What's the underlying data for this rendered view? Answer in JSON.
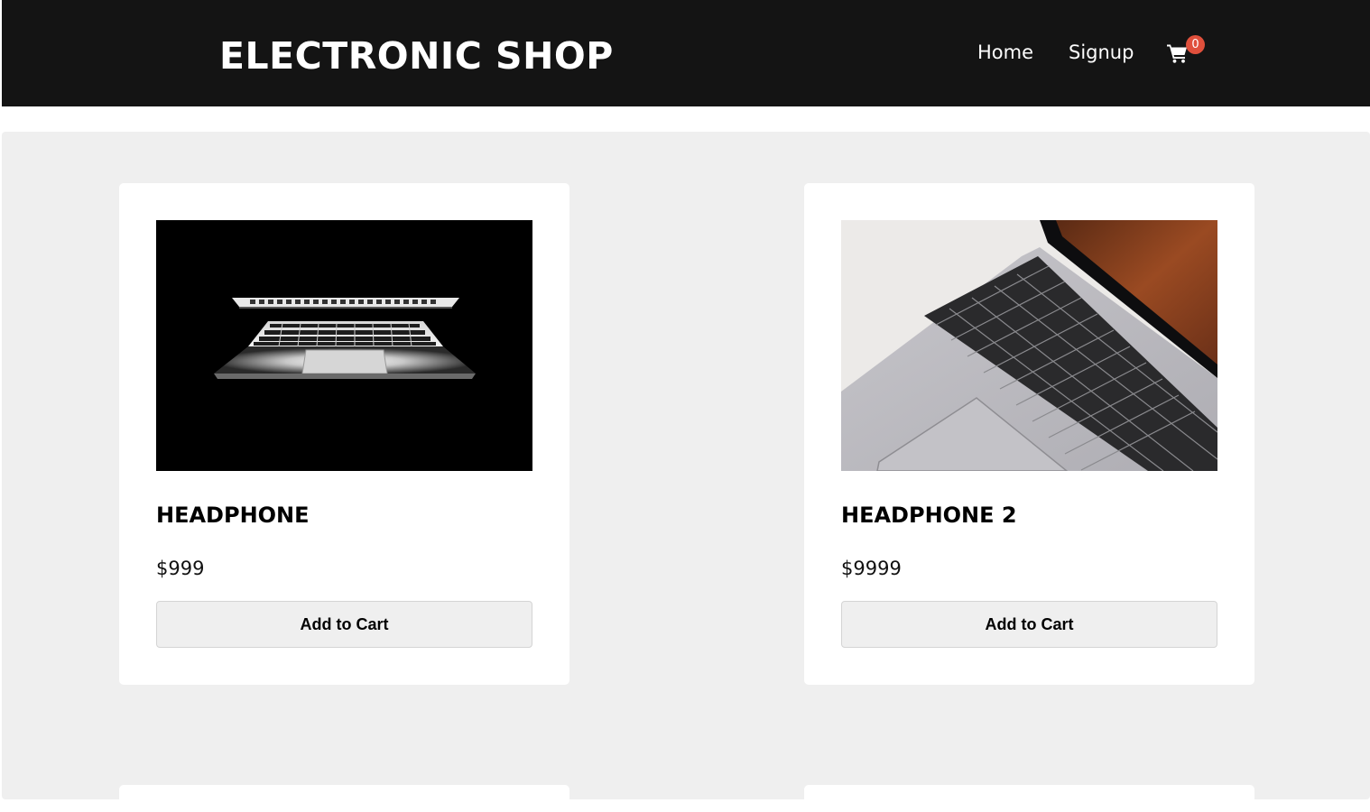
{
  "header": {
    "brand": "ELECTRONIC SHOP",
    "nav": [
      {
        "label": "Home"
      },
      {
        "label": "Signup"
      }
    ],
    "cart": {
      "icon": "shopping-cart-icon",
      "count": "0"
    }
  },
  "products": [
    {
      "title": "HEADPHONE",
      "price": "$999",
      "button_label": "Add to Cart",
      "image": "laptop-dark-photo"
    },
    {
      "title": "HEADPHONE 2",
      "price": "$9999",
      "button_label": "Add to Cart",
      "image": "laptop-keyboard-photo"
    }
  ],
  "colors": {
    "navbar_bg": "#141414",
    "page_bg": "#efefef",
    "card_bg": "#ffffff",
    "badge": "#e0503c"
  }
}
